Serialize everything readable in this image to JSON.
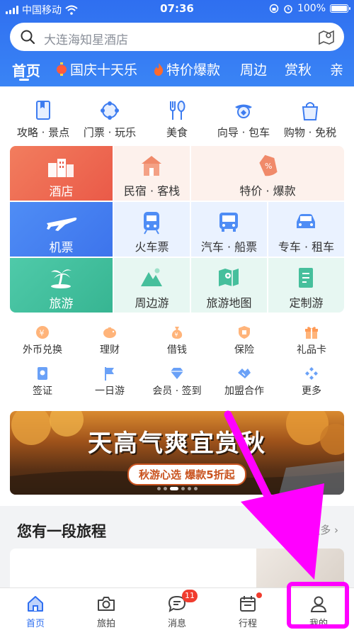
{
  "status": {
    "carrier": "中国移动",
    "time": "07:36",
    "battery": "100%"
  },
  "search": {
    "placeholder": "大连海知星酒店"
  },
  "tabs": [
    {
      "label": "首页"
    },
    {
      "label": "国庆十天乐"
    },
    {
      "label": "特价爆款"
    },
    {
      "label": "周边"
    },
    {
      "label": "赏秋"
    },
    {
      "label": "亲"
    }
  ],
  "top_icons": [
    {
      "label": "攻略 · 景点",
      "icon": "guide-book-icon"
    },
    {
      "label": "门票 · 玩乐",
      "icon": "ticket-icon"
    },
    {
      "label": "美食",
      "icon": "food-icon"
    },
    {
      "label": "向导 · 包车",
      "icon": "guide-icon"
    },
    {
      "label": "购物 · 免税",
      "icon": "shopping-bag-icon"
    }
  ],
  "grid": {
    "hotel": "酒店",
    "homestay": "民宿 · 客栈",
    "deals": "特价 · 爆款",
    "flights": "机票",
    "train": "火车票",
    "bus_ship": "汽车 · 船票",
    "car_rental": "专车 · 租车",
    "travel": "旅游",
    "nearby": "周边游",
    "travel_map": "旅游地图",
    "custom": "定制游"
  },
  "small_icons": [
    {
      "label": "外币兑换"
    },
    {
      "label": "理财"
    },
    {
      "label": "借钱"
    },
    {
      "label": "保险"
    },
    {
      "label": "礼品卡"
    },
    {
      "label": "签证"
    },
    {
      "label": "一日游"
    },
    {
      "label": "会员 · 签到"
    },
    {
      "label": "加盟合作"
    },
    {
      "label": "更多"
    }
  ],
  "banner": {
    "title": "天高气爽宜赏秋",
    "subtitle": "秋游心选 爆款5折起"
  },
  "trip": {
    "title": "您有一段旅程",
    "more": "更多 ›"
  },
  "tabbar": [
    {
      "label": "首页"
    },
    {
      "label": "旅拍"
    },
    {
      "label": "消息",
      "badge": "11"
    },
    {
      "label": "行程"
    },
    {
      "label": "我的"
    }
  ],
  "colors": {
    "brand": "#2f6ff0",
    "highlight": "#ff00ff",
    "badge": "#f03c2e"
  }
}
